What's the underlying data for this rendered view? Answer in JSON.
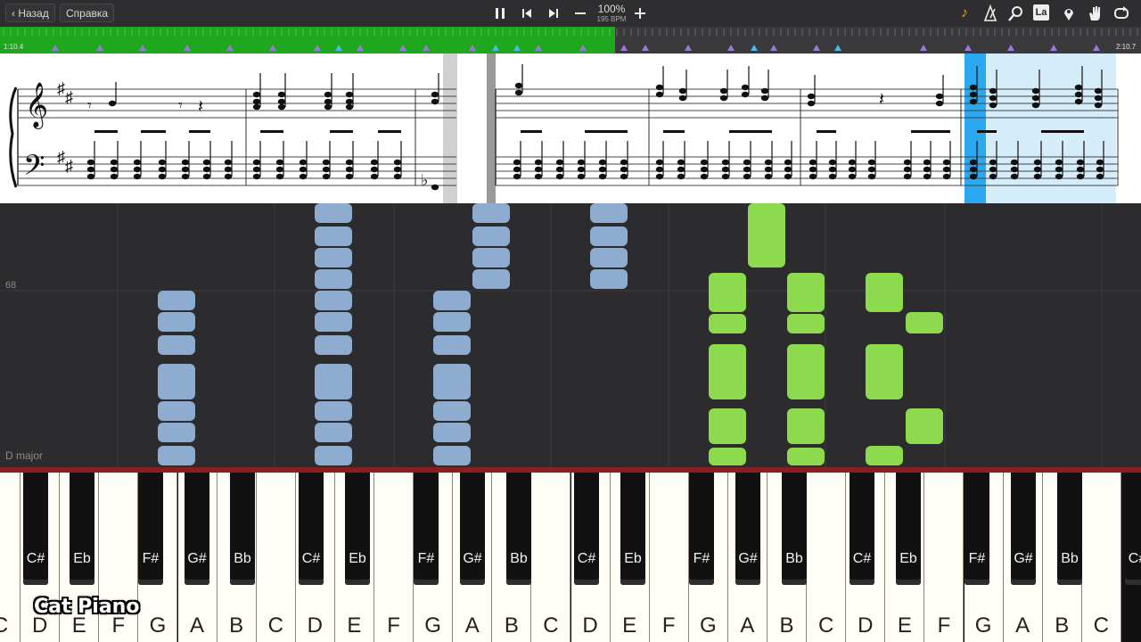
{
  "toolbar": {
    "back_label": "Назад",
    "help_label": "Справка",
    "tempo_percent": "100%",
    "tempo_bpm": "195 BPM",
    "icons": [
      "pause-icon",
      "prev-icon",
      "next-icon",
      "minus-icon",
      "plus-icon",
      "note-icon",
      "metronome-icon",
      "magnifier-icon",
      "label-icon",
      "location-pin-icon",
      "hand-icon",
      "loop-icon"
    ],
    "label_icon_text": "La"
  },
  "timeline": {
    "start_time": "1:10.4",
    "end_time": "2:10.7",
    "progress_fraction": 0.539
  },
  "piano_roll": {
    "pitch_label": "68",
    "key_label": "D major",
    "left_hand_color": "#8eacd0",
    "right_hand_color": "#8dda4e"
  },
  "keyboard": {
    "white_keys": [
      "C",
      "D",
      "E",
      "F",
      "G",
      "A",
      "B",
      "C",
      "D",
      "E",
      "F",
      "G",
      "A",
      "B",
      "C",
      "D",
      "E",
      "F",
      "G",
      "A",
      "B",
      "C",
      "D",
      "E",
      "F",
      "G",
      "A",
      "B",
      "C"
    ],
    "black_keys": [
      "C#",
      "Eb",
      "F#",
      "G#",
      "Bb",
      "C#",
      "Eb",
      "F#",
      "G#",
      "Bb",
      "C#",
      "Eb",
      "F#",
      "G#",
      "Bb",
      "C#",
      "Eb",
      "F#",
      "G#",
      "Bb",
      "C#"
    ],
    "pressed_color": "#8a1f1f"
  },
  "watermark": "Cat Piano",
  "colors": {
    "accent_green": "#1ea81e",
    "highlight_blue": "#2aa8f0",
    "toolbar_bg": "#2e2e30"
  }
}
